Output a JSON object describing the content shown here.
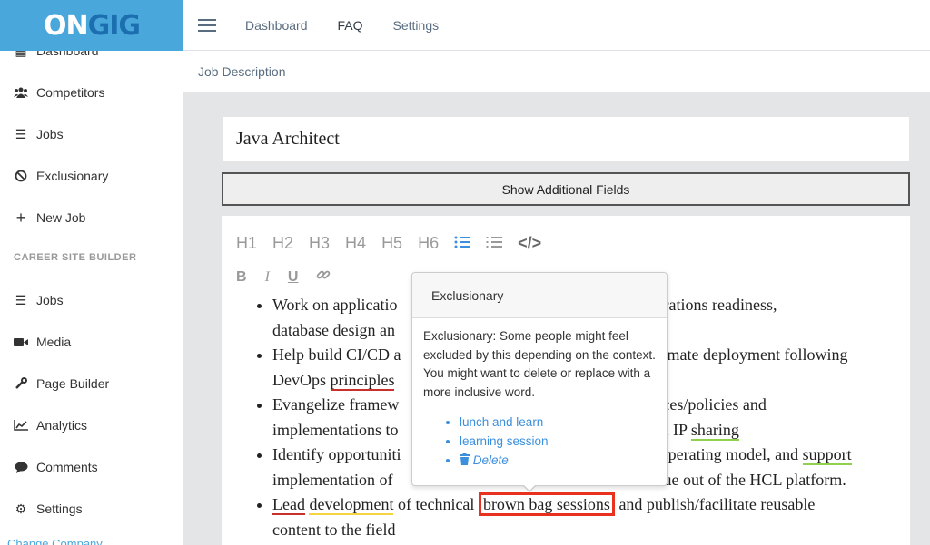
{
  "brand": {
    "part1": "ON",
    "part2": "GIG"
  },
  "sidebar": {
    "items": [
      {
        "label": "Dashboard",
        "icon": "dashboard-icon"
      },
      {
        "label": "Competitors",
        "icon": "users-icon"
      },
      {
        "label": "Jobs",
        "icon": "list-icon"
      },
      {
        "label": "Exclusionary",
        "icon": "ban-icon"
      },
      {
        "label": "New Job",
        "icon": "plus-icon"
      }
    ],
    "section_title": "CAREER SITE BUILDER",
    "builder_items": [
      {
        "label": "Jobs",
        "icon": "list-icon"
      },
      {
        "label": "Media",
        "icon": "video-icon"
      },
      {
        "label": "Page Builder",
        "icon": "wrench-icon"
      },
      {
        "label": "Analytics",
        "icon": "chart-icon"
      },
      {
        "label": "Comments",
        "icon": "comment-icon"
      },
      {
        "label": "Settings",
        "icon": "gear-icon"
      }
    ],
    "bottom_link": "Change Company"
  },
  "topbar": {
    "nav": [
      "Dashboard",
      "FAQ",
      "Settings"
    ],
    "active": "FAQ"
  },
  "breadcrumb": "Job Description",
  "job_title": "Java Architect",
  "additional_fields_label": "Show Additional Fields",
  "toolbar": {
    "headings": [
      "H1",
      "H2",
      "H3",
      "H4",
      "H5",
      "H6"
    ],
    "format": [
      "B",
      "I",
      "U"
    ]
  },
  "content": {
    "b1_a": "Work on applicatio",
    "b1_b": "on, operations readiness,",
    "b1_c": "database design an",
    "b1_d": ".",
    "b2_a": "Help build CI/CD a",
    "b2_b": "utomate deployment following",
    "b2_c": "DevOps ",
    "b2_u": "principles",
    "b3_a": "Evangelize framew",
    "b3_b": "ctices/policies and",
    "b3_c": "implementations to",
    "b3_d": "nd IP ",
    "b3_u": "sharing",
    "b4_a": "Identify opportuniti",
    "b4_b": "T operating model, and ",
    "b4_u": "support",
    "b4_c": "implementation of",
    "b4_d": "alue out of the HCL platform.",
    "b5_u1": "Lead",
    "b5_u2": "development",
    "b5_a": " of technical ",
    "b5_hl": "brown bag sessions",
    "b5_b": " and publish/facilitate reusable",
    "b5_c": "content to the field"
  },
  "popover": {
    "title": "Exclusionary",
    "message": "Exclusionary: Some people might feel excluded by this depending on the context. You might want to delete or replace with a more inclusive word.",
    "suggestions": [
      "lunch and learn",
      "learning session"
    ],
    "delete_label": "Delete"
  },
  "colors": {
    "brand": "#4aa7dc",
    "link": "#3b8fdc",
    "highlight": "#e8321f"
  }
}
